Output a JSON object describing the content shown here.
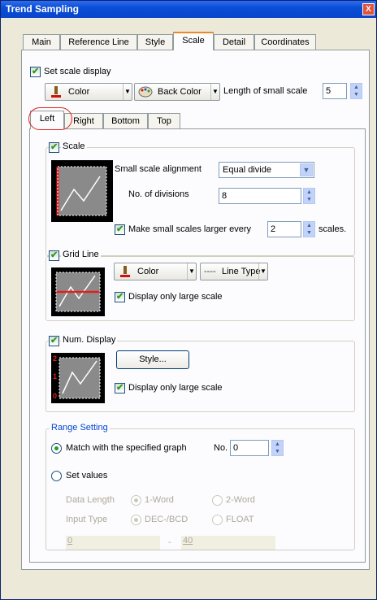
{
  "window": {
    "title": "Trend Sampling",
    "close": "X"
  },
  "tabs": [
    "Main",
    "Reference Line",
    "Style",
    "Scale",
    "Detail",
    "Coordinates"
  ],
  "scale_display": {
    "checkbox_label": "Set scale display",
    "color_label": "Color",
    "back_color_label": "Back Color",
    "small_scale_length_label": "Length of small scale",
    "small_scale_length_value": "5"
  },
  "subtabs": [
    "Left",
    "Right",
    "Bottom",
    "Top"
  ],
  "scale_group": {
    "label": "Scale",
    "alignment_label": "Small scale alignment",
    "alignment_value": "Equal divide",
    "divisions_label": "No. of divisions",
    "divisions_value": "8",
    "larger_every_label": "Make small scales larger every",
    "larger_every_value": "2",
    "scales_suffix": "scales."
  },
  "grid_group": {
    "label": "Grid Line",
    "color_label": "Color",
    "line_type_label": "Line Type",
    "display_large_label": "Display only large scale"
  },
  "num_group": {
    "label": "Num. Display",
    "style_button": "Style...",
    "display_large_label": "Display only large scale",
    "preview_numbers": [
      "2",
      "1",
      "0"
    ]
  },
  "range_group": {
    "label": "Range Setting",
    "match_label": "Match with the specified graph",
    "no_label": "No.",
    "no_value": "0",
    "set_values_label": "Set values",
    "data_length_label": "Data Length",
    "word1": "1-Word",
    "word2": "2-Word",
    "input_type_label": "Input Type",
    "dec_bcd": "DEC-/BCD",
    "float": "FLOAT",
    "min_value": "0",
    "dash": "-",
    "max_value": "40"
  },
  "colors": {
    "titlebar": "#0a4ed6",
    "accent_red": "#e02020",
    "check_green": "#21a121"
  }
}
